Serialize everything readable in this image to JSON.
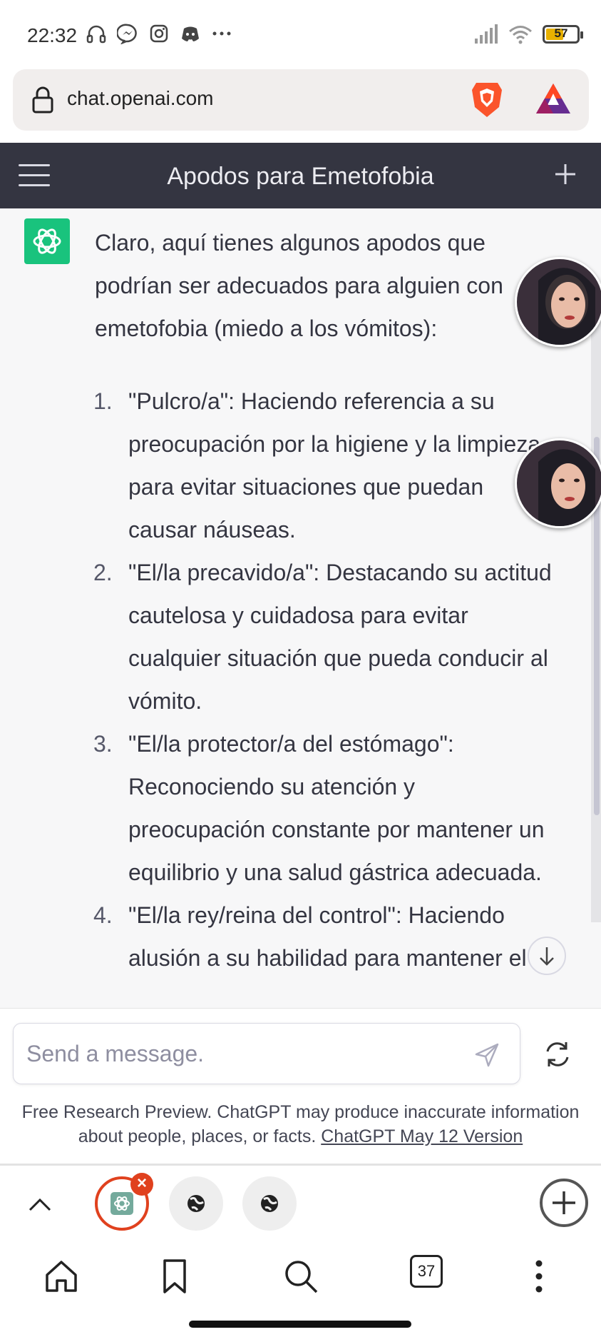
{
  "status_bar": {
    "time": "22:32",
    "battery": "57",
    "battery_level": 0.57,
    "icons": [
      "headphones-icon",
      "messenger-icon",
      "instagram-icon",
      "discord-icon",
      "more-icon",
      "signal-icon",
      "wifi-icon",
      "battery-icon"
    ]
  },
  "browser": {
    "url": "chat.openai.com",
    "brave_color": "#fb542b",
    "bat_color": "#9e1f63"
  },
  "header": {
    "title": "Apodos para Emetofobia"
  },
  "message": {
    "intro": "Claro, aquí tienes algunos apodos que podrían ser adecuados para alguien con emetofobia (miedo a los vómitos):",
    "items": [
      {
        "num": "1.",
        "text": "\"Pulcro/a\": Haciendo referencia a su preocupación por la higiene y la limpieza para evitar situaciones que puedan causar náuseas."
      },
      {
        "num": "2.",
        "text": "\"El/la precavido/a\": Destacando su actitud cautelosa y cuidadosa para evitar cualquier situación que pueda conducir al vómito."
      },
      {
        "num": "3.",
        "text": "\"El/la protector/a del estómago\": Reconociendo su atención y preocupación constante por mantener un equilibrio y una salud gástrica adecuada."
      },
      {
        "num": "4.",
        "text": "\"El/la rey/reina del control\": Haciendo alusión a su habilidad para mantener el"
      }
    ]
  },
  "composer": {
    "placeholder": "Send a message.",
    "disclaimer": "Free Research Preview. ChatGPT may produce inaccurate information about people, places, or facts.",
    "version_link": "ChatGPT May 12 Version"
  },
  "tabs": {
    "close_label": "×",
    "count": "37"
  },
  "colors": {
    "header_bg": "#343541",
    "gpt_green": "#19c37d",
    "close_red": "#e0411e"
  }
}
